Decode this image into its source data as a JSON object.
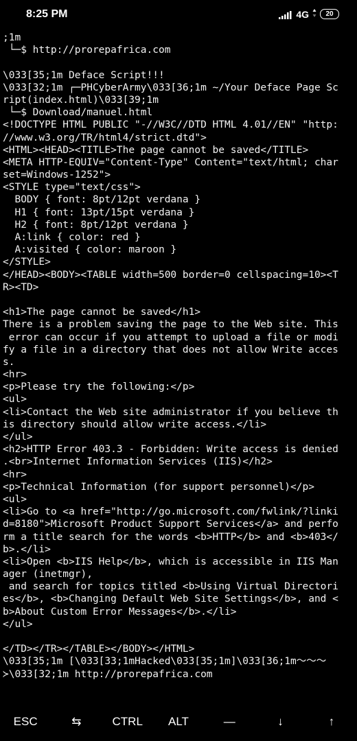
{
  "status_bar": {
    "time": "8:25 PM",
    "network": "4G",
    "battery": "20"
  },
  "terminal": {
    "lines": [
      ";1m",
      " └─$ http://prorepafrica.com",
      "",
      "\\033[35;1m Deface Script!!!",
      "\\033[32;1m ┌─PHCyberArmy\\033[36;1m ~/Your Deface Page Sc",
      "ript(index.html)\\033[39;1m",
      " └─$ Download/manuel.html",
      "<!DOCTYPE HTML PUBLIC \"-//W3C//DTD HTML 4.01//EN\" \"http:",
      "//www.w3.org/TR/html4/strict.dtd\">",
      "<HTML><HEAD><TITLE>The page cannot be saved</TITLE>",
      "<META HTTP-EQUIV=\"Content-Type\" Content=\"text/html; char",
      "set=Windows-1252\">",
      "<STYLE type=\"text/css\">",
      "  BODY { font: 8pt/12pt verdana }",
      "  H1 { font: 13pt/15pt verdana }",
      "  H2 { font: 8pt/12pt verdana }",
      "  A:link { color: red }",
      "  A:visited { color: maroon }",
      "</STYLE>",
      "</HEAD><BODY><TABLE width=500 border=0 cellspacing=10><T",
      "R><TD>",
      "",
      "<h1>The page cannot be saved</h1>",
      "There is a problem saving the page to the Web site. This",
      " error can occur if you attempt to upload a file or modi",
      "fy a file in a directory that does not allow Write acces",
      "s.",
      "<hr>",
      "<p>Please try the following:</p>",
      "<ul>",
      "<li>Contact the Web site administrator if you believe th",
      "is directory should allow write access.</li>",
      "</ul>",
      "<h2>HTTP Error 403.3 - Forbidden: Write access is denied",
      ".<br>Internet Information Services (IIS)</h2>",
      "<hr>",
      "<p>Technical Information (for support personnel)</p>",
      "<ul>",
      "<li>Go to <a href=\"http://go.microsoft.com/fwlink/?linki",
      "d=8180\">Microsoft Product Support Services</a> and perfo",
      "rm a title search for the words <b>HTTP</b> and <b>403</",
      "b>.</li>",
      "<li>Open <b>IIS Help</b>, which is accessible in IIS Man",
      "ager (inetmgr),",
      " and search for topics titled <b>Using Virtual Directori",
      "es</b>, <b>Changing Default Web Site Settings</b>, and <",
      "b>About Custom Error Messages</b>.</li>",
      "</ul>",
      "",
      "</TD></TR></TABLE></BODY></HTML>",
      "\\033[35;1m [\\033[33;1mHacked\\033[35;1m]\\033[36;1m〜〜〜",
      "≻\\033[32;1m http://prorepafrica.com"
    ]
  },
  "extra_keys": {
    "esc": "ESC",
    "tab": "⇆",
    "ctrl": "CTRL",
    "alt": "ALT",
    "dash": "—",
    "down": "↓",
    "up": "↑"
  }
}
